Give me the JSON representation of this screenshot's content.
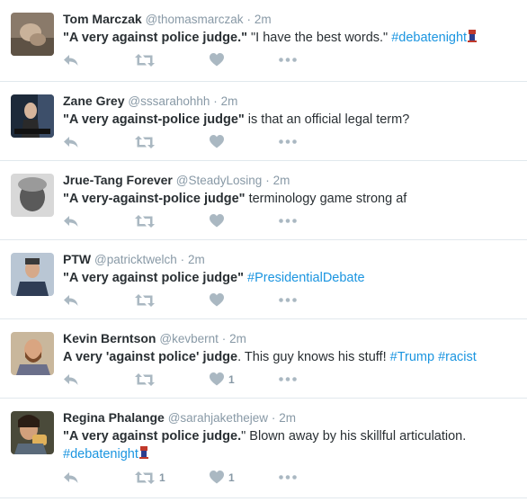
{
  "tweets": [
    {
      "fullname": "Tom Marczak",
      "handle": "@thomasmarczak",
      "time": "2m",
      "quote": "\"A very against police judge.\"",
      "rest": " \"I have the best words.\" ",
      "hashtags": [
        "#debatenight"
      ],
      "emoji": "debate-podium-emoji",
      "retweets": "",
      "likes": ""
    },
    {
      "fullname": "Zane Grey",
      "handle": "@sssarahohhh",
      "time": "2m",
      "quote": "\"A very against-police judge\"",
      "rest": " is that an official legal term?",
      "hashtags": [],
      "retweets": "",
      "likes": ""
    },
    {
      "fullname": "Jrue-Tang Forever",
      "handle": "@SteadyLosing",
      "time": "2m",
      "quote": "\"A very-against-police judge\"",
      "rest": " terminology game strong af",
      "hashtags": [],
      "retweets": "",
      "likes": ""
    },
    {
      "fullname": "PTW",
      "handle": "@patricktwelch",
      "time": "2m",
      "quote": "\"A very against police judge\"",
      "rest": " ",
      "hashtags": [
        "#PresidentialDebate"
      ],
      "retweets": "",
      "likes": ""
    },
    {
      "fullname": "Kevin Berntson",
      "handle": "@kevbernt",
      "time": "2m",
      "quote": "A very 'against police' judge",
      "rest": ". This guy knows his stuff! ",
      "hashtags": [
        "#Trump",
        "#racist"
      ],
      "retweets": "",
      "likes": "1"
    },
    {
      "fullname": "Regina Phalange",
      "handle": "@sarahjakethejew",
      "time": "2m",
      "quote": "\"A very against police judge.",
      "rest": "\" Blown away by his skillful articulation.",
      "hashtags": [
        "#debatenight"
      ],
      "emoji": "debate-podium-emoji",
      "retweets": "1",
      "likes": "1"
    }
  ],
  "sep": "·",
  "icons": {
    "reply": "reply-icon",
    "retweet": "retweet-icon",
    "like": "heart-icon",
    "more": "more-dots-icon"
  },
  "colors": {
    "name": "#292f33",
    "meta": "#8899a6",
    "hashtag": "#1b95e0",
    "action": "#aab8c2",
    "divider": "#e1e8ed"
  }
}
